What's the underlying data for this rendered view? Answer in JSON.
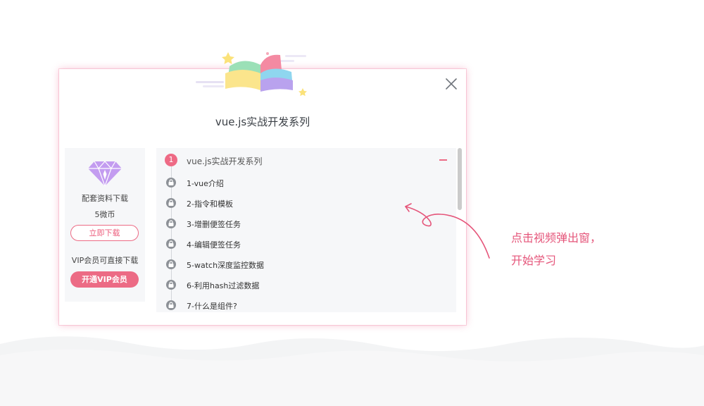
{
  "modal": {
    "title": "vue.js实战开发系列"
  },
  "left_panel": {
    "resource_label": "配套资料下载",
    "price": "5微币",
    "download_button": "立即下载",
    "vip_note": "VIP会员可直接下载",
    "vip_button": "开通VIP会员"
  },
  "chapter": {
    "number": "1",
    "title": "vue.js实战开发系列",
    "lessons": [
      {
        "label": "1-vue介绍"
      },
      {
        "label": "2-指令和模板"
      },
      {
        "label": "3-增删便签任务"
      },
      {
        "label": "4-编辑便签任务"
      },
      {
        "label": "5-watch深度监控数据"
      },
      {
        "label": "6-利用hash过滤数据"
      },
      {
        "label": "7-什么是组件?"
      }
    ]
  },
  "annotation": {
    "line1": "点击视频弹出窗，",
    "line2": "开始学习"
  },
  "colors": {
    "accent": "#ec6b85",
    "panel_bg": "#f6f7f9",
    "lock_gray": "#8d9197",
    "annotation": "#e5557a"
  }
}
